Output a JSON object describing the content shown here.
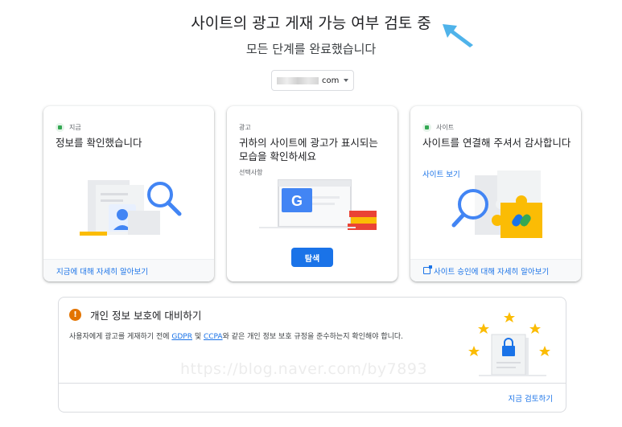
{
  "header": {
    "title": "사이트의 광고 게재 가능 여부 검토 중",
    "subtitle": "모든 단계를 완료했습니다"
  },
  "site_selector": {
    "suffix": "com"
  },
  "cards": [
    {
      "status": "지금",
      "heading": "정보를 확인했습니다",
      "footer_link": "지금에 대해 자세히 알아보기"
    },
    {
      "status": "광고",
      "heading": "귀하의 사이트에 광고가 표시되는 모습을 확인하세요",
      "optional": "선택사항",
      "button": "탐색"
    },
    {
      "status": "사이트",
      "heading": "사이트를 연결해 주셔서 감사합니다",
      "link": "사이트 보기",
      "footer_link": "사이트 승인에 대해 자세히 알아보기"
    }
  ],
  "privacy": {
    "title": "개인 정보 보호에 대비하기",
    "desc_before": "사용자에게 광고를 게재하기 전에 ",
    "gdpr": "GDPR",
    "desc_mid": " 및 ",
    "ccpa": "CCPA",
    "desc_after": "와 같은 개인 정보 보호 규정을 준수하는지 확인해야 합니다.",
    "review_link": "지금 검토하기"
  },
  "watermark": "https://blog.naver.com/by7893",
  "colors": {
    "accent": "#1a73e8",
    "success": "#34a853",
    "warning": "#e37400",
    "arrow": "#4fb3ea",
    "star": "#fbbc04"
  }
}
